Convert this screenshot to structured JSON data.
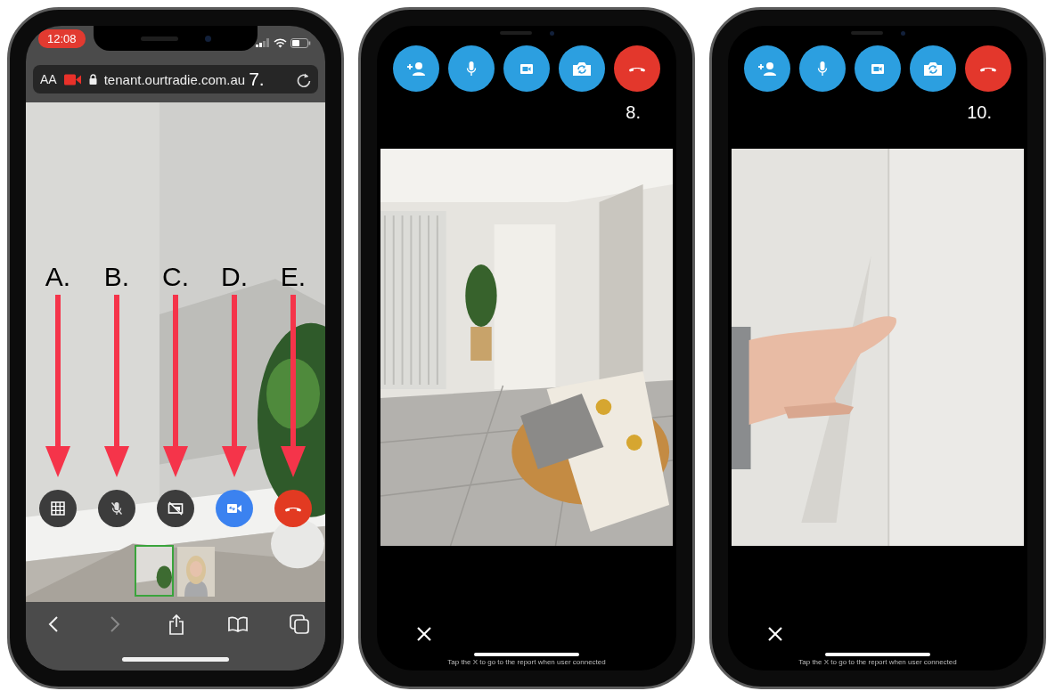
{
  "phones": [
    {
      "kind": "browser",
      "status_bar": {
        "time": "12:08"
      },
      "address_bar": {
        "text_size_button": "AA",
        "url": "tenant.ourtradie.com.au"
      },
      "step_label": "7.",
      "call_controls": [
        {
          "kind": "grid",
          "label": "A."
        },
        {
          "kind": "mic-off",
          "label": "B."
        },
        {
          "kind": "camera-off",
          "label": "C."
        },
        {
          "kind": "switch-camera",
          "label": "D."
        },
        {
          "kind": "hang-up",
          "label": "E."
        }
      ],
      "toolbar": [
        {
          "kind": "back",
          "disabled": false
        },
        {
          "kind": "forward",
          "disabled": true
        },
        {
          "kind": "share",
          "disabled": false
        },
        {
          "kind": "bookmarks",
          "disabled": false
        },
        {
          "kind": "tabs",
          "disabled": false
        }
      ]
    },
    {
      "kind": "call",
      "step_label": "8.",
      "call_controls": [
        {
          "kind": "add-person"
        },
        {
          "kind": "mic"
        },
        {
          "kind": "video"
        },
        {
          "kind": "flip-camera"
        },
        {
          "kind": "hang-up"
        }
      ],
      "hint": "Tap the X to go to the report when user connected"
    },
    {
      "kind": "call",
      "step_label": "10.",
      "call_controls": [
        {
          "kind": "add-person"
        },
        {
          "kind": "mic"
        },
        {
          "kind": "video"
        },
        {
          "kind": "flip-camera"
        },
        {
          "kind": "hang-up"
        }
      ],
      "hint": "Tap the X to go to the report when user connected"
    }
  ]
}
